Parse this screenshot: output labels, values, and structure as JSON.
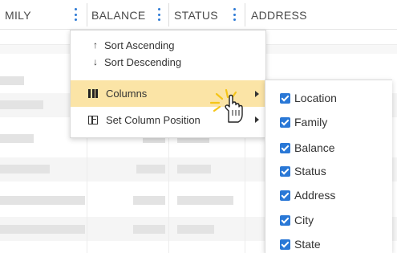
{
  "grid": {
    "headers": [
      {
        "label": "MILY"
      },
      {
        "label": "BALANCE"
      },
      {
        "label": "STATUS"
      },
      {
        "label": "ADDRESS"
      }
    ]
  },
  "column_menu": {
    "items": [
      {
        "label": "Sort Ascending",
        "icon": "arrow-up-icon",
        "arrow": "↑"
      },
      {
        "label": "Sort Descending",
        "icon": "arrow-down-icon",
        "arrow": "↓"
      },
      {
        "label": "Columns",
        "icon": "columns-icon",
        "highlighted": true,
        "has_submenu": true
      },
      {
        "label": "Set Column Position",
        "icon": "column-position-icon",
        "has_submenu": true
      }
    ]
  },
  "columns_submenu": {
    "items": [
      {
        "label": "Location",
        "checked": true
      },
      {
        "label": "Family",
        "checked": true
      },
      {
        "label": "Balance",
        "checked": true
      },
      {
        "label": "Status",
        "checked": true
      },
      {
        "label": "Address",
        "checked": true
      },
      {
        "label": "City",
        "checked": true
      },
      {
        "label": "State",
        "checked": true
      }
    ]
  },
  "colors": {
    "accent": "#2a78d6",
    "highlight": "#fbe4a6",
    "click_burst": "#f5c518"
  }
}
